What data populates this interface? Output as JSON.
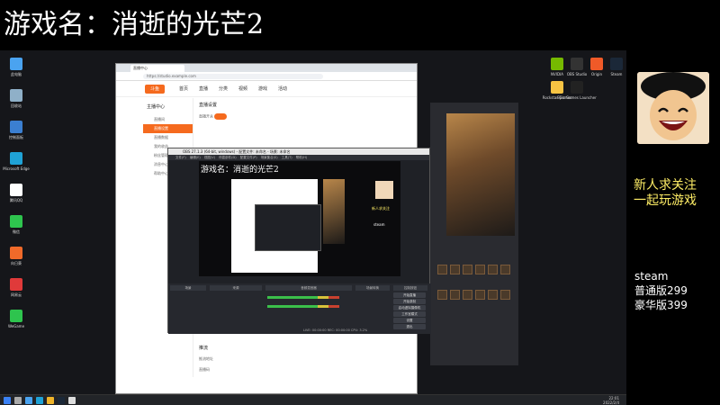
{
  "overlay": {
    "title": "游戏名：消逝的光芒2"
  },
  "stream_panel": {
    "follow_line1": "新人求关注",
    "follow_line2": "一起玩游戏",
    "platform": "steam",
    "price_standard": "普通版299",
    "price_deluxe": "豪华版399"
  },
  "desktop_icons_left": [
    {
      "label": "此电脑",
      "icon": "computer-icon",
      "color": "#4aa3f0"
    },
    {
      "label": "回收站",
      "icon": "recycle-bin-icon",
      "color": "#8fb0c8"
    },
    {
      "label": "控制面板",
      "icon": "control-panel-icon",
      "color": "#3b7fd1"
    },
    {
      "label": "Microsoft Edge",
      "icon": "edge-icon",
      "color": "#1fa2d6"
    },
    {
      "label": "腾讯QQ",
      "icon": "qq-icon",
      "color": "#ffffff"
    },
    {
      "label": "微信",
      "icon": "wechat-icon",
      "color": "#2ec44e"
    },
    {
      "label": "向日葵",
      "icon": "app-icon",
      "color": "#f06a2a"
    },
    {
      "label": "网易云",
      "icon": "netease-icon",
      "color": "#e03a3a"
    },
    {
      "label": "WeGame",
      "icon": "wegame-icon",
      "color": "#2ec44e"
    }
  ],
  "desktop_icons_right": [
    {
      "label": "NVIDIA",
      "icon": "nvidia-icon",
      "color": "#76b900"
    },
    {
      "label": "OBS Studio",
      "icon": "obs-icon",
      "color": "#333333"
    },
    {
      "label": "Origin",
      "icon": "origin-icon",
      "color": "#f05a28"
    },
    {
      "label": "Steam",
      "icon": "steam-icon",
      "color": "#1b2838"
    },
    {
      "label": "Rockstar Games",
      "icon": "rockstar-icon",
      "color": "#f6c343"
    },
    {
      "label": "Epic Games Launcher",
      "icon": "epic-icon",
      "color": "#222222"
    }
  ],
  "browser": {
    "tab_title": "直播中心",
    "url": "https://studio.example.com",
    "logo_text": "斗鱼",
    "nav": [
      "首页",
      "直播",
      "分类",
      "视频",
      "游戏",
      "活动"
    ],
    "sidebar_title": "主播中心",
    "sidebar_items": [
      "直播间",
      "直播设置",
      "直播数据",
      "我的收益",
      "粉丝管理",
      "消息中心",
      "帮助中心"
    ],
    "active_item": "直播设置",
    "section_title": "直播设置",
    "toggle_label": "直播开关",
    "footer_title": "推流",
    "footer_label1": "推流地址",
    "footer_label2": "直播码"
  },
  "obs": {
    "title": "OBS 27.1.3 (64-bit, windows) - 配置文件: 未命名 - 场景: 未命名",
    "menu": [
      "文件(F)",
      "编辑(E)",
      "视图(V)",
      "停靠部件(D)",
      "配置文件(P)",
      "场景集合(S)",
      "工具(T)",
      "帮助(H)"
    ],
    "docks": [
      "场景",
      "来源",
      "音频混音器",
      "场景转换",
      "控制按钮"
    ],
    "controls": [
      "开始直播",
      "开始录制",
      "启动虚拟摄像机",
      "工作室模式",
      "设置",
      "退出"
    ],
    "status": "LIVE: 00:00:00  REC: 00:00:00  CPU: 3.2%"
  },
  "taskbar": {
    "time": "22:01",
    "date": "2022/2/4"
  }
}
